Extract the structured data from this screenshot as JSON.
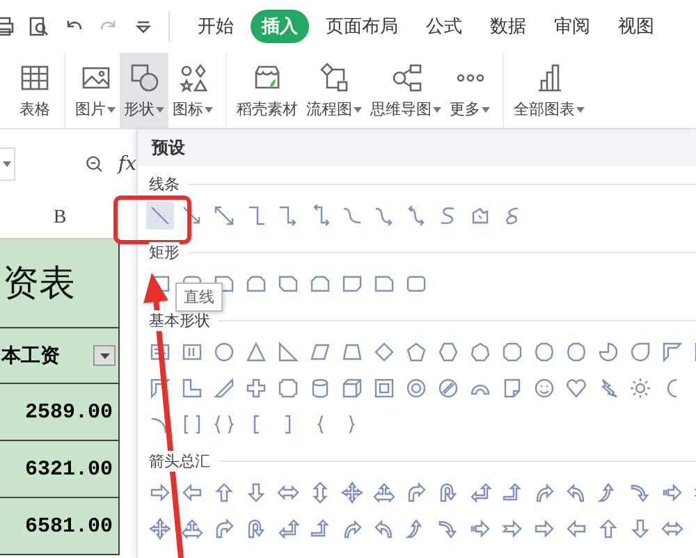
{
  "tabs": [
    {
      "label": "开始",
      "selected": false
    },
    {
      "label": "插入",
      "selected": true
    },
    {
      "label": "页面布局",
      "selected": false
    },
    {
      "label": "公式",
      "selected": false
    },
    {
      "label": "数据",
      "selected": false
    },
    {
      "label": "审阅",
      "selected": false
    },
    {
      "label": "视图",
      "selected": false
    }
  ],
  "ribbon": [
    {
      "label": "表格",
      "dropdown": false,
      "active": false
    },
    {
      "label": "图片",
      "dropdown": true,
      "active": false
    },
    {
      "label": "形状",
      "dropdown": true,
      "active": true
    },
    {
      "label": "图标",
      "dropdown": true,
      "active": false
    },
    {
      "label": "稻壳素材",
      "dropdown": false,
      "active": false
    },
    {
      "label": "流程图",
      "dropdown": true,
      "active": false
    },
    {
      "label": "思维导图",
      "dropdown": true,
      "active": false
    },
    {
      "label": "更多",
      "dropdown": true,
      "active": false
    },
    {
      "label": "全部图表",
      "dropdown": true,
      "active": false
    }
  ],
  "formula_bar": {
    "function_label": "fx"
  },
  "sheet": {
    "column_header": "B",
    "title": "资表",
    "header": "本工资",
    "values": [
      "2589.00",
      "6321.00",
      "6581.00"
    ]
  },
  "shapes_panel": {
    "heading": "预设",
    "sections": [
      {
        "label": "线条"
      },
      {
        "label": "矩形"
      },
      {
        "label": "基本形状"
      },
      {
        "label": "箭头总汇"
      }
    ]
  },
  "tooltip": {
    "text": "直线"
  }
}
